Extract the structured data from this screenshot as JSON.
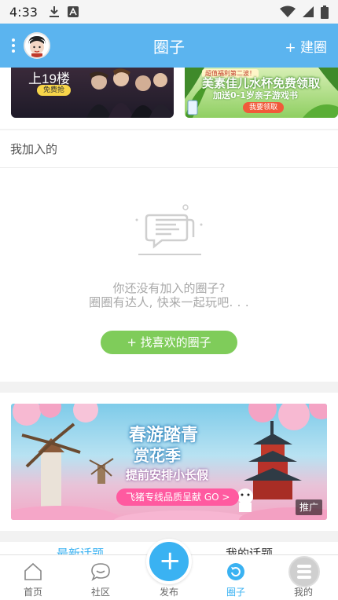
{
  "status_bar": {
    "time": "4:33"
  },
  "header": {
    "title": "圈子",
    "create_label": "+ 建圈"
  },
  "top_banners": {
    "left": {
      "text": "上19楼",
      "button": "免费抢"
    },
    "right": {
      "top_tag": "超值福利第二波！",
      "title": "美素佳儿水杯免费领取",
      "subtitle": "加送0-1岁亲子游戏书",
      "button": "我要领取"
    }
  },
  "joined": {
    "section_title": "我加入的",
    "empty_line1": "你还没有加入的圈子?",
    "empty_line2": "圈圈有达人, 快来一起玩吧. . .",
    "find_button": "+ 找喜欢的圈子"
  },
  "ad": {
    "title_line1": "春游踏青",
    "title_line2": "赏花季",
    "subtitle": "提前安排小长假",
    "pill": "飞猪专线品质呈献 GO >",
    "tag": "推广"
  },
  "peek_tabs": [
    "最新话题",
    "我的话题"
  ],
  "bottom_nav": {
    "items": [
      {
        "label": "首页",
        "icon": "home-icon"
      },
      {
        "label": "社区",
        "icon": "chat-icon"
      },
      {
        "label": "发布",
        "icon": "plus-icon"
      },
      {
        "label": "圈子",
        "icon": "circle-refresh-icon"
      },
      {
        "label": "我的",
        "icon": "avatar-icon"
      }
    ],
    "active_color": "#3ab2f2",
    "inactive_color": "#666666"
  },
  "colors": {
    "header_bg": "#5bb4ef",
    "find_button_bg": "#7fcc5a",
    "publish_bg": "#3ab2f2"
  }
}
